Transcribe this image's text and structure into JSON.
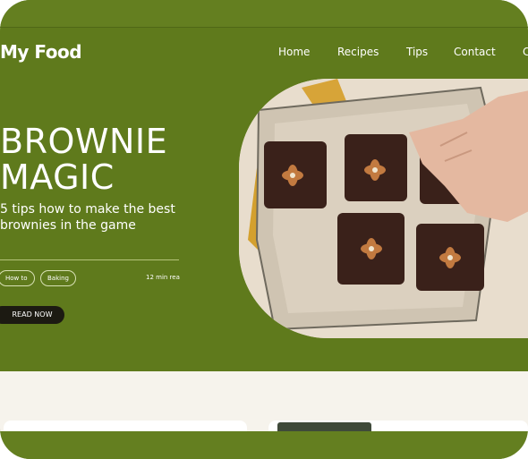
{
  "brand": {
    "logo": "My Food"
  },
  "nav": {
    "items": [
      "Home",
      "Recipes",
      "Tips",
      "Contact",
      "C"
    ]
  },
  "hero": {
    "title_line1": "BROWNIE",
    "title_line2": "MAGIC",
    "subtitle": "5 tips how to make the best brownies in the game",
    "tags": [
      "How to",
      "Baking"
    ],
    "read_time": "12 min rea",
    "cta": "READ NOW",
    "image": "brownies-with-almonds-photo"
  },
  "colors": {
    "brand_green": "#5f7a1c",
    "cream": "#f6f3ec",
    "button_dark": "#1c1a12"
  }
}
